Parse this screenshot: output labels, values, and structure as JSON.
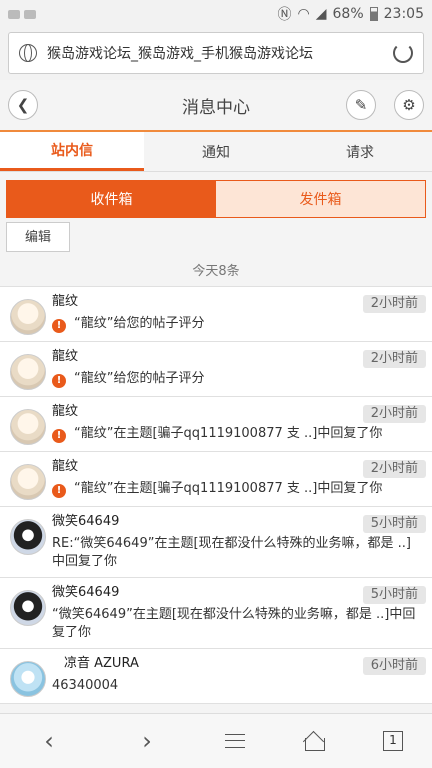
{
  "status_bar": {
    "battery": "68%",
    "time": "23:05"
  },
  "browser": {
    "url_text": "猴岛游戏论坛_猴岛游戏_手机猴岛游戏论坛"
  },
  "header": {
    "title": "消息中心"
  },
  "tabs": [
    {
      "label": "站内信",
      "active": true
    },
    {
      "label": "通知",
      "active": false
    },
    {
      "label": "请求",
      "active": false
    }
  ],
  "box_switch": {
    "inbox": "收件箱",
    "outbox": "发件箱"
  },
  "edit_label": "编辑",
  "day_label": "今天8条",
  "messages": [
    {
      "name": "龍纹",
      "time": "2小时前",
      "text": "“龍纹”给您的帖子评分",
      "icon": "warn",
      "avatar": "a1"
    },
    {
      "name": "龍纹",
      "time": "2小时前",
      "text": "“龍纹”给您的帖子评分",
      "icon": "warn",
      "avatar": "a1"
    },
    {
      "name": "龍纹",
      "time": "2小时前",
      "text": "“龍纹”在主题[骗子qq1119100877 支 ..]中回复了你",
      "icon": "warn",
      "avatar": "a1"
    },
    {
      "name": "龍纹",
      "time": "2小时前",
      "text": "“龍纹”在主题[骗子qq1119100877 支 ..]中回复了你",
      "icon": "warn",
      "avatar": "a1"
    },
    {
      "name": "微笑64649",
      "time": "5小时前",
      "text": "RE:“微笑64649”在主题[现在都没什么特殊的业务嘛，都是 ..]中回复了你",
      "icon": "",
      "avatar": "a2"
    },
    {
      "name": "微笑64649",
      "time": "5小时前",
      "text": "“微笑64649”在主题[现在都没什么特殊的业务嘛，都是 ..]中回复了你",
      "icon": "",
      "avatar": "a2"
    },
    {
      "name": "凉音 AZURA",
      "time": "6小时前",
      "text": "46340004",
      "icon": "",
      "avatar": "a3"
    }
  ],
  "bottom_nav": {
    "tab_count": "1"
  },
  "colors": {
    "accent": "#e95a1b",
    "accent_light": "#fde5d6"
  }
}
